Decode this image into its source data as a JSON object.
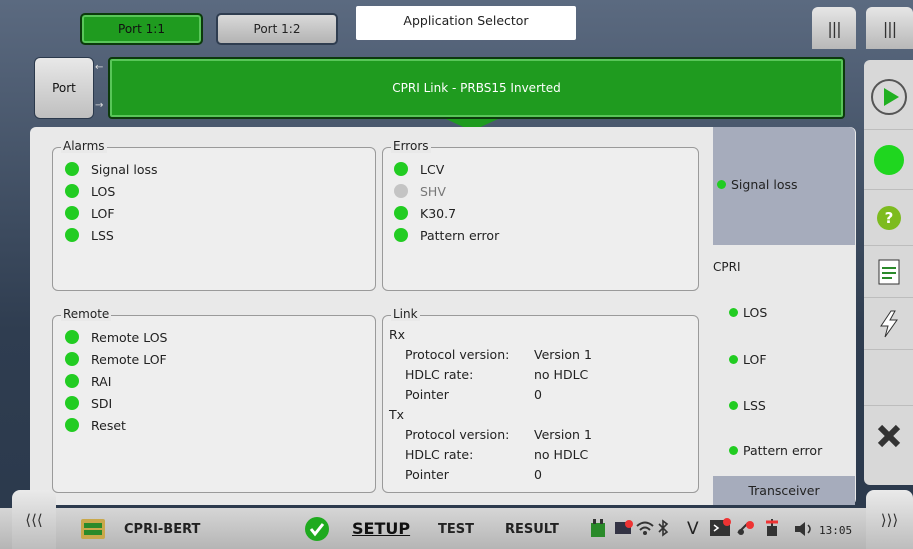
{
  "ports": {
    "active": "Port 1:1",
    "inactive": "Port 1:2"
  },
  "app_selector": "Application Selector",
  "port_button": "Port",
  "status": "CPRI Link - PRBS15 Inverted",
  "alarms": {
    "title": "Alarms",
    "items": [
      "Signal loss",
      "LOS",
      "LOF",
      "LSS"
    ]
  },
  "errors": {
    "title": "Errors",
    "items": [
      "LCV",
      "SHV",
      "K30.7",
      "Pattern error"
    ]
  },
  "remote": {
    "title": "Remote",
    "items": [
      "Remote LOS",
      "Remote LOF",
      "RAI",
      "SDI",
      "Reset"
    ]
  },
  "link": {
    "title": "Link",
    "rx_label": "Rx",
    "tx_label": "Tx",
    "rx": [
      {
        "k": "Protocol version:",
        "v": "Version 1"
      },
      {
        "k": "HDLC rate:",
        "v": "no HDLC"
      },
      {
        "k": "Pointer",
        "v": "0"
      }
    ],
    "tx": [
      {
        "k": "Protocol version:",
        "v": "Version 1"
      },
      {
        "k": "HDLC rate:",
        "v": "no HDLC"
      },
      {
        "k": "Pointer",
        "v": "0"
      }
    ]
  },
  "summary": {
    "signal_loss": "Signal loss",
    "cpri": "CPRI",
    "los": "LOS",
    "lof": "LOF",
    "lss": "LSS",
    "pattern_error": "Pattern error",
    "transceiver": "Transceiver"
  },
  "bottom": {
    "app_name": "CPRI-BERT",
    "setup": "SETUP",
    "test": "TEST",
    "result": "RESULT",
    "v_label": "V",
    "time": "13:05"
  },
  "colors": {
    "ok": "#22cc22",
    "inactive": "#c4c4c4",
    "status_bg": "#1f9b1f"
  }
}
